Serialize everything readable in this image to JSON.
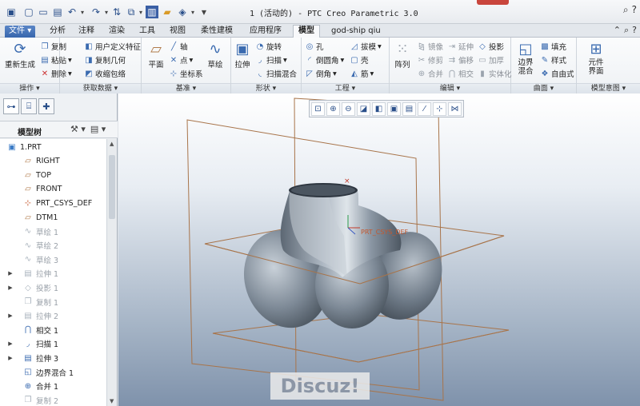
{
  "window": {
    "title": "1 (活动的) - PTC Creo Parametric 3.0"
  },
  "tabs": [
    {
      "label": "文件",
      "arrow": "▾"
    },
    {
      "label": "分析"
    },
    {
      "label": "注释"
    },
    {
      "label": "渲染"
    },
    {
      "label": "工具"
    },
    {
      "label": "视图"
    },
    {
      "label": "柔性建模"
    },
    {
      "label": "应用程序"
    },
    {
      "label": "模型"
    },
    {
      "label": "god-ship qiu"
    }
  ],
  "ribbon": {
    "operations": {
      "label": "操作",
      "regen": "重新生成",
      "copy": "复制",
      "paste": "粘贴",
      "delete": "删除"
    },
    "get_data": {
      "label": "获取数据",
      "udf": "用户定义特征",
      "copy_geom": "复制几何",
      "shrinkwrap": "收缩包络"
    },
    "datum": {
      "label": "基准",
      "plane": "平面",
      "axis": "轴",
      "point": "点",
      "csys": "坐标系",
      "sketch": "草绘"
    },
    "shapes": {
      "label": "形状",
      "extrude": "拉伸",
      "revolve": "旋转",
      "sweep": "扫描",
      "swept_blend": "扫描混合"
    },
    "engineering": {
      "label": "工程",
      "hole": "孔",
      "round": "倒圆角",
      "chamfer": "倒角",
      "draft": "拔模",
      "shell": "壳",
      "rib": "筋"
    },
    "editing": {
      "label": "编辑",
      "pattern": "阵列",
      "mirror": "镜像",
      "trim": "修剪",
      "merge": "合并",
      "extend": "延伸",
      "offset": "偏移",
      "intersect": "相交",
      "project": "投影",
      "thicken": "加厚",
      "solidify": "实体化"
    },
    "surfaces": {
      "label": "曲面",
      "boundary_blend": "边界混合",
      "fill": "填充",
      "style": "样式",
      "freestyle": "自由式"
    },
    "model_intent": {
      "label": "模型意图",
      "component_interface": "元件界面"
    }
  },
  "model_tree": {
    "title": "模型树",
    "items": [
      {
        "label": "1.PRT",
        "icon": "part-icon",
        "dim": false,
        "expand": false
      },
      {
        "label": "RIGHT",
        "icon": "datum-plane-icon",
        "dim": false,
        "expand": false
      },
      {
        "label": "TOP",
        "icon": "datum-plane-icon",
        "dim": false,
        "expand": false
      },
      {
        "label": "FRONT",
        "icon": "datum-plane-icon",
        "dim": false,
        "expand": false
      },
      {
        "label": "PRT_CSYS_DEF",
        "icon": "csys-icon",
        "dim": false,
        "expand": false
      },
      {
        "label": "DTM1",
        "icon": "datum-plane-icon",
        "dim": false,
        "expand": false
      },
      {
        "label": "草绘 1",
        "icon": "sketch-icon",
        "dim": true,
        "expand": false
      },
      {
        "label": "草绘 2",
        "icon": "sketch-icon",
        "dim": true,
        "expand": false
      },
      {
        "label": "草绘 3",
        "icon": "sketch-icon",
        "dim": true,
        "expand": false
      },
      {
        "label": "拉伸 1",
        "icon": "extrude-icon",
        "dim": true,
        "expand": true
      },
      {
        "label": "投影 1",
        "icon": "project-icon",
        "dim": true,
        "expand": true
      },
      {
        "label": "复制 1",
        "icon": "copy-icon",
        "dim": true,
        "expand": false
      },
      {
        "label": "拉伸 2",
        "icon": "extrude-icon",
        "dim": true,
        "expand": true
      },
      {
        "label": "相交 1",
        "icon": "intersect-icon",
        "dim": false,
        "expand": false
      },
      {
        "label": "扫描 1",
        "icon": "sweep-icon",
        "dim": false,
        "expand": true
      },
      {
        "label": "拉伸 3",
        "icon": "extrude-icon",
        "dim": false,
        "expand": true
      },
      {
        "label": "边界混合 1",
        "icon": "boundary-blend-icon",
        "dim": false,
        "expand": false
      },
      {
        "label": "合并 1",
        "icon": "merge-icon",
        "dim": false,
        "expand": false
      },
      {
        "label": "复制 2",
        "icon": "copy-icon",
        "dim": true,
        "expand": false
      }
    ]
  },
  "viewport": {
    "csys_label": "PRT_CSYS_DEF",
    "watermark": "Discuz!",
    "toolbar_icons": [
      "refit-icon",
      "zoom-in-icon",
      "zoom-out-icon",
      "repaint-icon",
      "display-style-icon",
      "saved-views-icon",
      "view-manager-icon",
      "datum-display-icon",
      "spin-center-icon",
      "annotation-display-icon"
    ]
  },
  "colors": {
    "accent": "#3766ad",
    "datum": "#b07a4a",
    "model": "#8f9aa6"
  }
}
